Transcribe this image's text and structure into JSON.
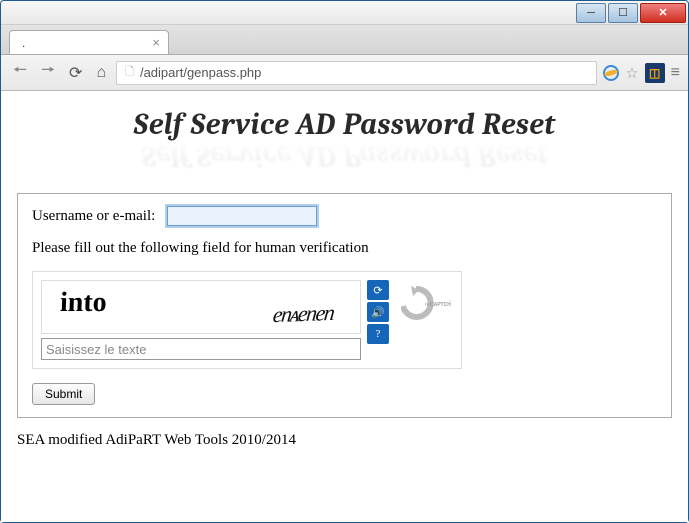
{
  "window": {
    "tab_title": "."
  },
  "toolbar": {
    "url": "/adipart/genpass.php"
  },
  "page": {
    "title": "Self Service AD Password Reset"
  },
  "form": {
    "username_label": "Username or e-mail:",
    "verification_text": "Please fill out the following field for human verification",
    "captcha_word1": "into",
    "captcha_word2": "enᴀenen",
    "captcha_placeholder": "Saisissez le texte",
    "submit_label": "Submit"
  },
  "captcha": {
    "logo_label": "reCAPTCHA™"
  },
  "footer": {
    "text": "SEA modified AdiPaRT Web Tools 2010/2014"
  }
}
